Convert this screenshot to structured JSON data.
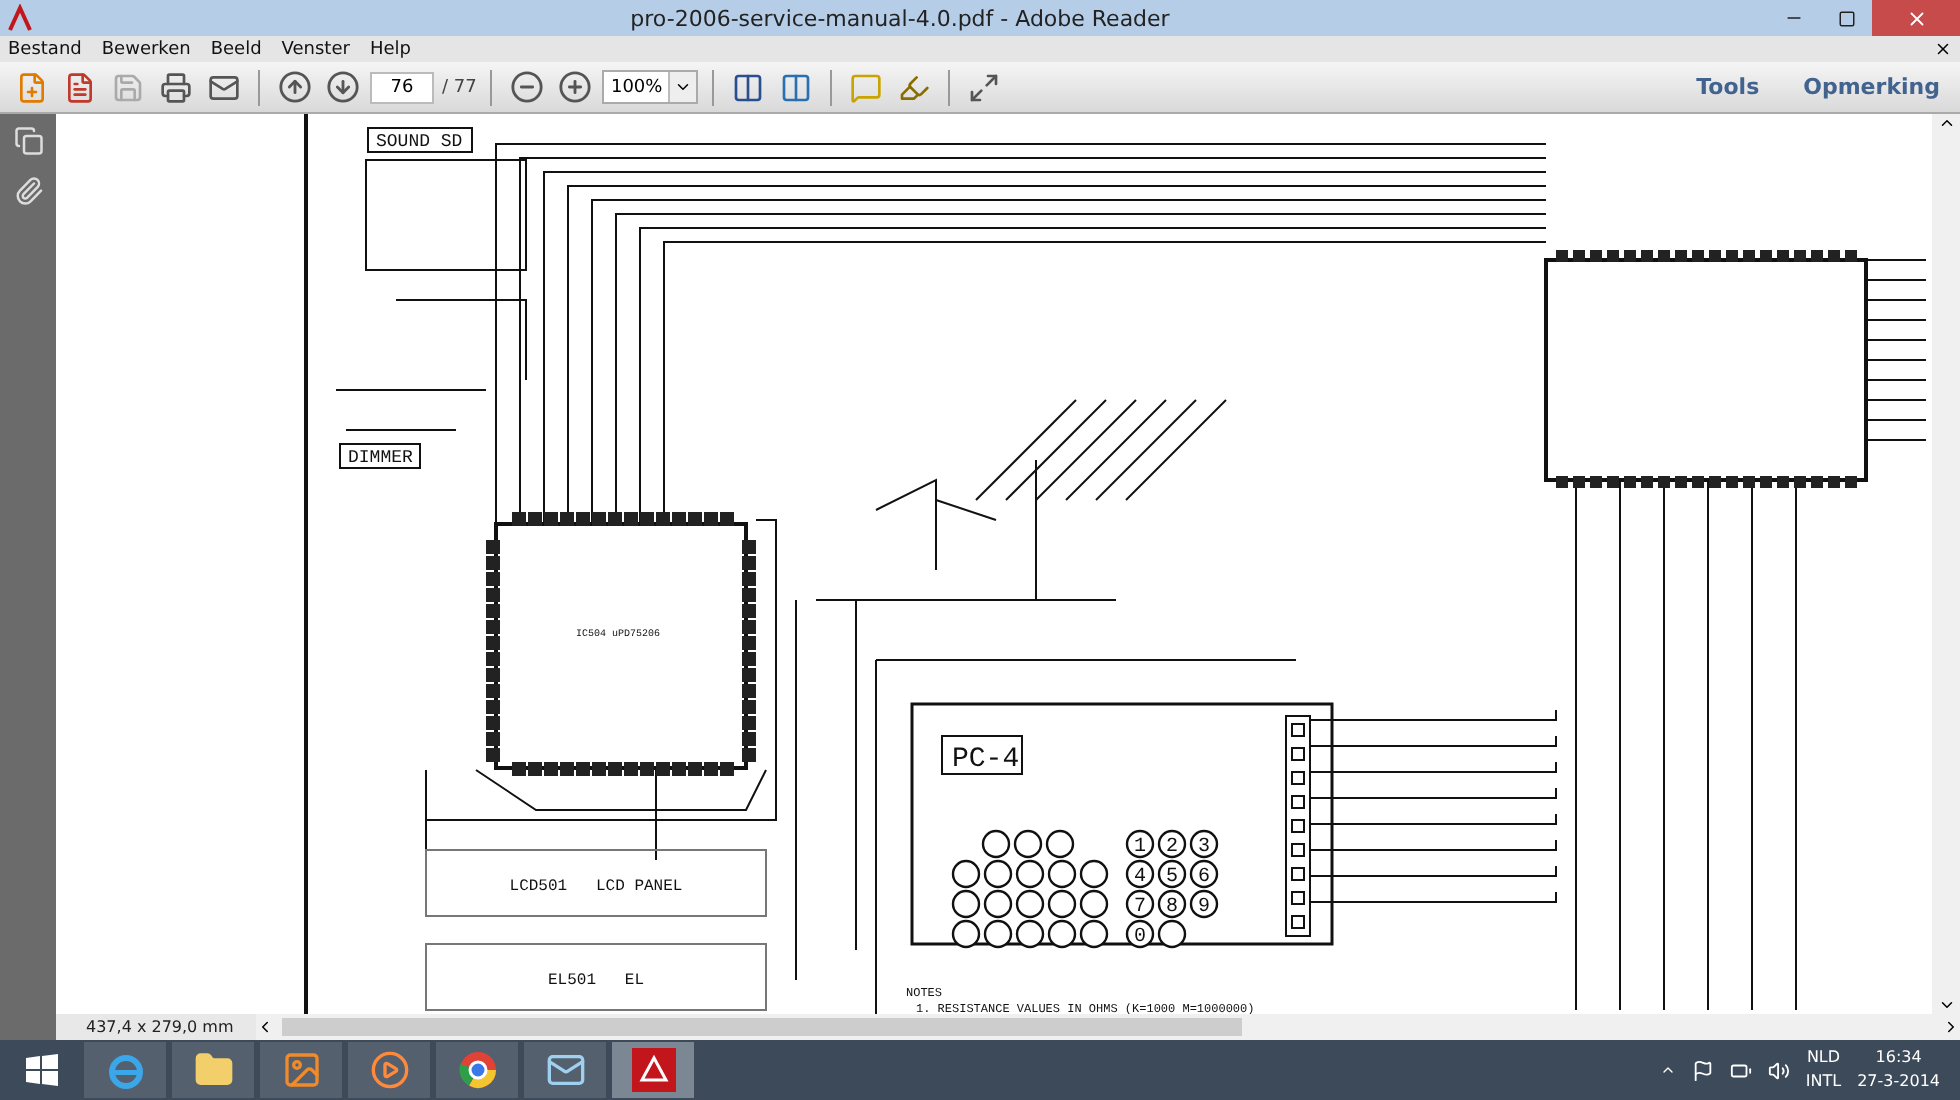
{
  "window": {
    "title": "pro-2006-service-manual-4.0.pdf - Adobe Reader"
  },
  "menu": [
    "Bestand",
    "Bewerken",
    "Beeld",
    "Venster",
    "Help"
  ],
  "toolbar": {
    "page_current": "76",
    "page_total": "/ 77",
    "zoom": "100%",
    "right_links": [
      "Tools",
      "Opmerking"
    ]
  },
  "schematic": {
    "sound_label": "SOUND SD",
    "dimmer_label": "DIMMER",
    "ic504_label": "IC504 uPD75206",
    "board_label": "PC-4",
    "lcd_label": "LCD501   LCD PANEL",
    "el_label": "EL501   EL",
    "keypad_keys": [
      "1",
      "2",
      "3",
      "4",
      "5",
      "6",
      "7",
      "8",
      "9",
      "0"
    ],
    "notes_title": "NOTES",
    "notes_line": "1. RESISTANCE VALUES IN OHMS (K=1000 M=1000000)"
  },
  "status_bar": {
    "page_size": "437,4 x 279,0 mm"
  },
  "taskbar": {
    "apps": [
      {
        "kind": "browser-e",
        "selected": false
      },
      {
        "kind": "folder",
        "selected": false
      },
      {
        "kind": "photos",
        "selected": false
      },
      {
        "kind": "media",
        "selected": false
      },
      {
        "kind": "chrome",
        "selected": false
      },
      {
        "kind": "mail",
        "selected": false
      },
      {
        "kind": "pdf",
        "selected": true
      }
    ],
    "language": [
      "NLD",
      "INTL"
    ],
    "time": "16:34",
    "date": "27-3-2014"
  }
}
